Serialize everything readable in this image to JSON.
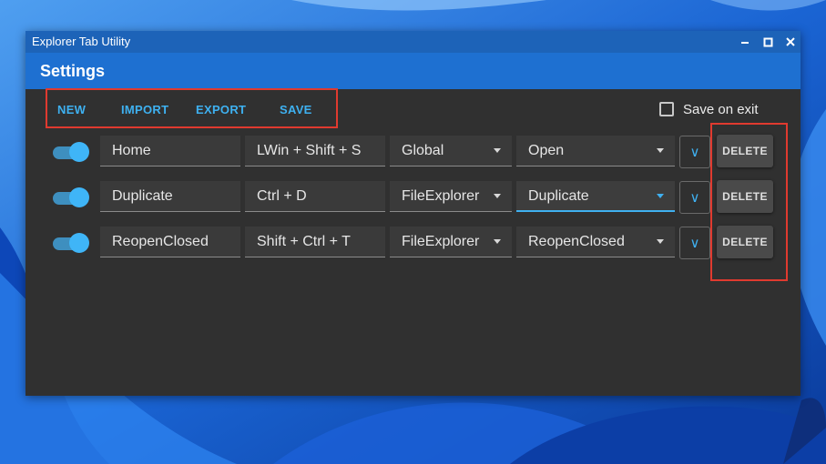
{
  "window": {
    "title": "Explorer Tab Utility",
    "heading": "Settings",
    "controls": [
      "minimize-icon",
      "maximize-icon",
      "close-icon"
    ]
  },
  "toolbar": {
    "new_label": "NEW",
    "import_label": "IMPORT",
    "export_label": "EXPORT",
    "save_label": "SAVE"
  },
  "save_on_exit": {
    "label": "Save on exit",
    "checked": false
  },
  "rows": [
    {
      "enabled": true,
      "name": "Home",
      "hotkey": "LWin + Shift + S",
      "scope": "Global",
      "action": "Open",
      "expand_label": "∨",
      "delete_label": "DELETE"
    },
    {
      "enabled": true,
      "name": "Duplicate",
      "hotkey": "Ctrl + D",
      "scope": "FileExplorer",
      "action": "Duplicate",
      "expand_label": "∨",
      "delete_label": "DELETE"
    },
    {
      "enabled": true,
      "name": "ReopenClosed",
      "hotkey": "Shift + Ctrl + T",
      "scope": "FileExplorer",
      "action": "ReopenClosed",
      "expand_label": "∨",
      "delete_label": "DELETE"
    }
  ],
  "colors": {
    "accent": "#3fb0f0",
    "titlebar": "#1d63b8",
    "header": "#1e70d1",
    "background": "#303030",
    "annotation": "#e03a2f"
  }
}
